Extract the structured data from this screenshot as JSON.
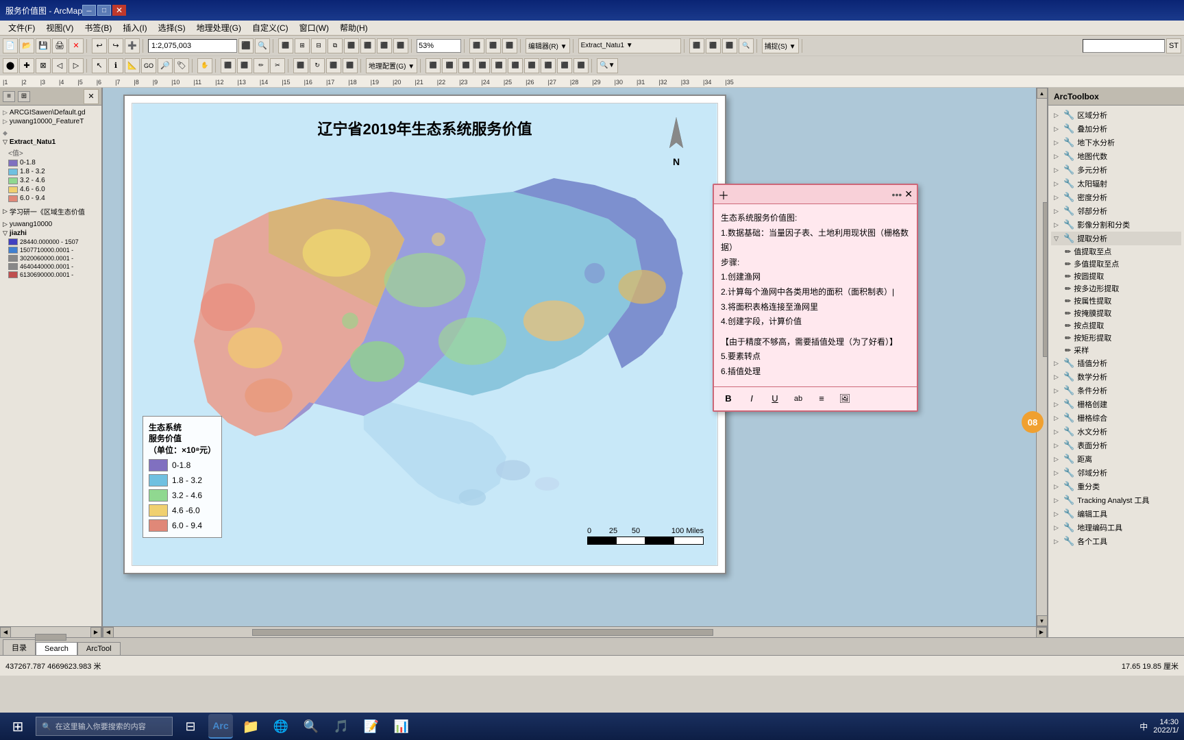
{
  "window": {
    "title": "服务价值图 - ArcMap"
  },
  "menubar": {
    "items": [
      "文件(F)",
      "视图(V)",
      "书签(B)",
      "插入(I)",
      "选择(S)",
      "地理处理(G)",
      "自定义(C)",
      "窗口(W)",
      "帮助(H)"
    ]
  },
  "toolbar1": {
    "scale_input": "1:2,075,003",
    "zoom_input": "53%",
    "editor_label": "编辑器(R) ▼",
    "capture_label": "捕捉(S) ▼",
    "extract_label": "Extract_Natu1 ▼"
  },
  "toolbar2": {
    "geo_label": "地理配置(G) ▼"
  },
  "left_panel": {
    "layers": [
      {
        "name": "",
        "color": ""
      },
      {
        "name": "ARCGISawen\\Default.gd",
        "color": ""
      },
      {
        "name": "yuwang10000_FeatureT",
        "color": ""
      },
      {
        "name": "",
        "color": ""
      },
      {
        "name": "Extract_Natu1",
        "color": ""
      },
      {
        "name": "<值>",
        "color": ""
      },
      {
        "name": "0-1.8",
        "color": "#8080c0"
      },
      {
        "name": "1.8 - 3.2",
        "color": "#80c0e0"
      },
      {
        "name": "3.2 - 4.6",
        "color": "#a0d0a0"
      },
      {
        "name": "4.6 - 6.0",
        "color": "#f0d080"
      },
      {
        "name": "6.0 - 9.4",
        "color": "#e08080"
      },
      {
        "name": "学习研一《区域生态价值",
        "color": ""
      },
      {
        "name": "yuwang10000",
        "color": ""
      },
      {
        "name": "jiazhi",
        "color": ""
      },
      {
        "name": "28440.000000 - 1507",
        "color": "#4040c0"
      },
      {
        "name": "1507710000.0001 -",
        "color": "#4080c0"
      },
      {
        "name": "3020060000.0001 -",
        "color": "#888888"
      },
      {
        "name": "4640440000.0001 -",
        "color": "#888888"
      },
      {
        "name": "6130690000.0001 -",
        "color": "#c05050"
      }
    ]
  },
  "map": {
    "title": "辽宁省2019年生态系统服务价值",
    "legend_title": "生态系统\n服务价值\n（单位：×10⁸元）",
    "legend_items": [
      {
        "label": "0-1.8",
        "color": "#8070c0"
      },
      {
        "label": "1.8 - 3.2",
        "color": "#70c0e0"
      },
      {
        "label": "3.2 - 4.6",
        "color": "#90d890"
      },
      {
        "label": "4.6 -6.0",
        "color": "#f0d070"
      },
      {
        "label": "6.0 - 9.4",
        "color": "#e08878"
      }
    ],
    "scale_labels": [
      "0",
      "25",
      "50",
      "100 Miles"
    ]
  },
  "note_popup": {
    "content": "生态系统服务价值图:\n1.数据基础：当量因子表、土地利用现状图（栅格数据）\n步骤:\n1.创建渔网\n2.计算每个渔网中各类用地的面积（面积制表）|\n3.将面积表格连接至渔网里\n4.创建字段，计算价值\n\n【由于精度不够高，需要插值处理（为了好看）】\n5.要素转点\n6.插值处理",
    "format_buttons": [
      "B",
      "I",
      "U",
      "ab",
      "≡",
      "🖼"
    ]
  },
  "arcToolbox": {
    "title": "ArcToolbox",
    "groups": [
      {
        "name": "区域分析",
        "expanded": false
      },
      {
        "name": "叠加分析",
        "expanded": false
      },
      {
        "name": "地下水分析",
        "expanded": false
      },
      {
        "name": "地图代数",
        "expanded": false
      },
      {
        "name": "多元分析",
        "expanded": false
      },
      {
        "name": "太阳辐射",
        "expanded": false
      },
      {
        "name": "密度分析",
        "expanded": false
      },
      {
        "name": "邻部分析",
        "expanded": false
      },
      {
        "name": "影像分割和分类",
        "expanded": false
      },
      {
        "name": "提取分析",
        "expanded": true,
        "children": [
          "值提取至点",
          "多值提取至点",
          "按圆提取",
          "按多边形提取",
          "按属性提取",
          "按掩膜提取",
          "按点提取",
          "按矩形提取",
          "采样"
        ]
      },
      {
        "name": "插值分析",
        "expanded": false
      },
      {
        "name": "数学分析",
        "expanded": false
      },
      {
        "name": "条件分析",
        "expanded": false
      },
      {
        "name": "栅格创建",
        "expanded": false
      },
      {
        "name": "栅格综合",
        "expanded": false
      },
      {
        "name": "水文分析",
        "expanded": false
      },
      {
        "name": "表面分析",
        "expanded": false
      },
      {
        "name": "距离",
        "expanded": false
      },
      {
        "name": "邻域分析",
        "expanded": false
      },
      {
        "name": "重分类",
        "expanded": false
      },
      {
        "name": "Tracking Analyst 工具",
        "expanded": false
      },
      {
        "name": "编辑工具",
        "expanded": false
      },
      {
        "name": "地理编码工具",
        "expanded": false
      },
      {
        "name": "各个工具",
        "expanded": false
      }
    ]
  },
  "bottom_tabs": {
    "tabs": [
      "目录",
      "Search",
      "ArcTool"
    ]
  },
  "status_bar": {
    "coordinates": "437267.787  4669623.983 米",
    "scale": "17.65  19.85 厘米"
  },
  "taskbar": {
    "search_placeholder": "在这里输入你要搜索的内容",
    "time": "14:30",
    "date": "2022/1/",
    "ime": "中",
    "notification": "中"
  }
}
